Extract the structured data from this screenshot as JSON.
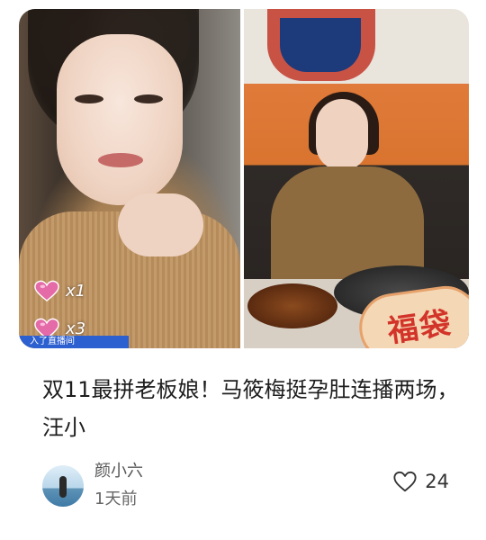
{
  "feed_card": {
    "cover": {
      "left_photo": {
        "gifts": [
          {
            "icon": "heart-gift-icon",
            "count": "x1"
          },
          {
            "icon": "heart-gift-icon",
            "count": "x3"
          }
        ],
        "bottom_banner": "入了直播间"
      },
      "right_photo": {
        "badge": "福袋"
      }
    },
    "headline": "双11最拼老板娘！马筱梅挺孕肚连播两场，汪小",
    "author": {
      "name": "颜小六",
      "time": "1天前"
    },
    "like": {
      "icon": "heart-outline-icon",
      "count": "24"
    },
    "colors": {
      "badge_text": "#d3342a",
      "gift_heart": "#e46aa8",
      "banner": "#2c5fd0"
    }
  }
}
